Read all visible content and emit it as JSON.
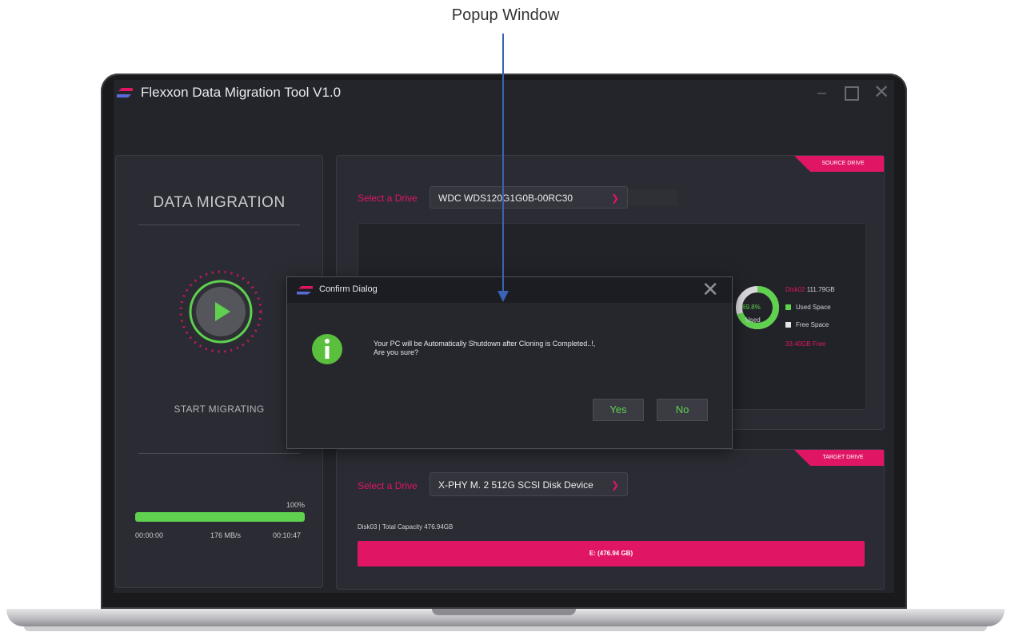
{
  "annotation": {
    "label": "Popup Window"
  },
  "app": {
    "title": "Flexxon Data Migration Tool V1.0"
  },
  "left_panel": {
    "title": "DATA MIGRATION",
    "start_label": "START MIGRATING",
    "progress": {
      "value": 1.0,
      "label": "100%",
      "elapsed": "00:00:00",
      "speed": "176 MB/s",
      "remaining": "00:10:47"
    }
  },
  "source": {
    "tag": "SOURCE DRIVE",
    "select_label": "Select a Drive",
    "selected_drive": "WDC WDS120G1G0B-00RC30",
    "disk_name": "Disk02",
    "disk_size": "111.79GB",
    "used_pct_label": "69.8%",
    "used_caption": "Used",
    "used_fraction": 0.698,
    "legend_used": "Used Space",
    "legend_free": "Free Space",
    "free_text": "33.40GB Free"
  },
  "target": {
    "tag": "TARGET DRIVE",
    "select_label": "Select a Drive",
    "selected_drive": "X-PHY M. 2 512G  SCSI Disk Device",
    "disk_info": "Disk03 | Total Capacity 476.94GB",
    "partition": "E: (476.94 GB)"
  },
  "dialog": {
    "title": "Confirm Dialog",
    "message_line1": "Your PC will be Automatically Shutdown after Cloning is Completed..!,",
    "message_line2": "Are you sure?",
    "yes_label": "Yes",
    "no_label": "No"
  },
  "colors": {
    "accent": "#e01563",
    "green": "#5fd14f",
    "bg": "#24252b",
    "callout": "#3a62b5"
  }
}
